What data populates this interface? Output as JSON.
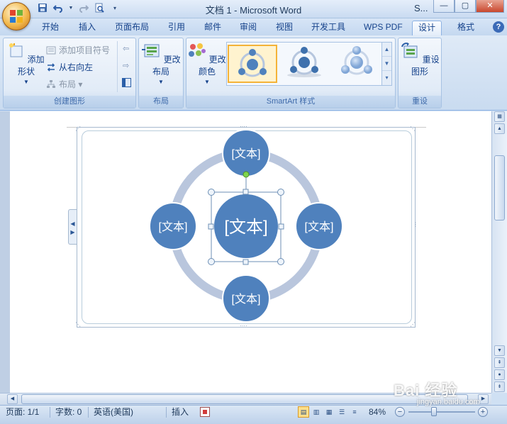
{
  "window": {
    "title": "文档 1 - Microsoft Word",
    "title_right_fragment": "S..."
  },
  "tabs": [
    {
      "label": "开始"
    },
    {
      "label": "插入"
    },
    {
      "label": "页面布局"
    },
    {
      "label": "引用"
    },
    {
      "label": "邮件"
    },
    {
      "label": "审阅"
    },
    {
      "label": "视图"
    },
    {
      "label": "开发工具"
    },
    {
      "label": "WPS PDF"
    },
    {
      "label": "设计",
      "active": true
    },
    {
      "label": "格式"
    }
  ],
  "ribbon": {
    "create_graphic": {
      "label": "创建图形",
      "add_shape": "添加形状",
      "add_bullet": "添加项目符号",
      "right_to_left": "从右向左",
      "layout": "布局"
    },
    "layouts": {
      "label": "布局",
      "change_layout": "更改布局"
    },
    "smartart_styles": {
      "label": "SmartArt 样式",
      "change_colors": "更改颜色"
    },
    "reset": {
      "label": "重设",
      "reset_graphic": "重设图形"
    }
  },
  "smartart": {
    "center": "[文本]",
    "top": "[文本]",
    "left": "[文本]",
    "right": "[文本]",
    "bottom": "[文本]"
  },
  "statusbar": {
    "page": "页面: 1/1",
    "words": "字数: 0",
    "language": "英语(美国)",
    "mode": "插入",
    "zoom": "84%"
  },
  "watermark": {
    "brand": "Bai 经验",
    "url": "jingyan.baidu.com"
  },
  "colors": {
    "node_fill": "#4f81bd",
    "ring": "#b9c6dd",
    "selection": "#6d8fb5",
    "ribbon_text": "#15428b"
  }
}
